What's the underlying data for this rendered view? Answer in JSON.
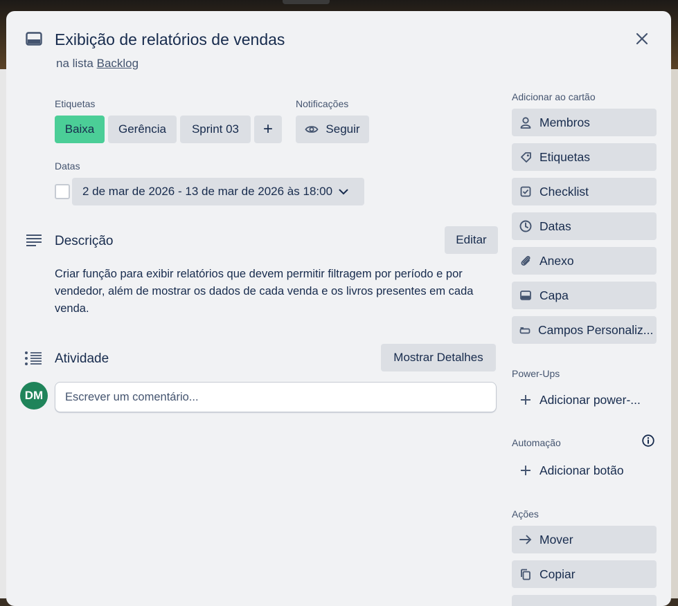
{
  "card": {
    "title": "Exibição de relatórios de vendas",
    "list_prefix": "na lista",
    "list_name": "Backlog"
  },
  "labels_section": {
    "heading": "Etiquetas",
    "labels": [
      {
        "text": "Baixa",
        "color": "#4bce97"
      },
      {
        "text": "Gerência"
      },
      {
        "text": "Sprint 03"
      }
    ],
    "add_symbol": "+"
  },
  "notifications": {
    "heading": "Notificações",
    "follow_label": "Seguir"
  },
  "dates": {
    "heading": "Datas",
    "value": "2 de mar de 2026 - 13 de mar de 2026 às 18:00"
  },
  "description": {
    "heading": "Descrição",
    "edit_label": "Editar",
    "text": "Criar função para exibir relatórios que devem permitir filtragem por período e por vendedor, além de mostrar os dados de cada venda e os livros presentes em cada venda."
  },
  "activity": {
    "heading": "Atividade",
    "details_label": "Mostrar Detalhes",
    "comment_placeholder": "Escrever um comentário...",
    "avatar_initials": "DM"
  },
  "sidebar": {
    "add_heading": "Adicionar ao cartão",
    "add_items": [
      {
        "label": "Membros",
        "icon": "person-icon"
      },
      {
        "label": "Etiquetas",
        "icon": "tag-icon"
      },
      {
        "label": "Checklist",
        "icon": "checklist-icon"
      },
      {
        "label": "Datas",
        "icon": "clock-icon"
      },
      {
        "label": "Anexo",
        "icon": "paperclip-icon"
      },
      {
        "label": "Capa",
        "icon": "cover-icon"
      },
      {
        "label": "Campos Personaliz...",
        "icon": "custom-fields-icon"
      }
    ],
    "powerups_heading": "Power-Ups",
    "powerups_add": "Adicionar power-...",
    "automation_heading": "Automação",
    "automation_add": "Adicionar botão",
    "actions_heading": "Ações",
    "actions": [
      {
        "label": "Mover",
        "icon": "arrow-right-icon"
      },
      {
        "label": "Copiar",
        "icon": "copy-icon"
      }
    ]
  },
  "colors": {
    "modal_bg": "#f1f2f4",
    "button_bg": "#dcdfe4",
    "text": "#172b4d",
    "avatar": "#1f845a"
  }
}
